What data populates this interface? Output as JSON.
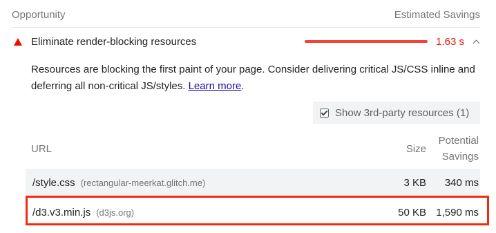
{
  "header": {
    "opportunity_label": "Opportunity",
    "savings_label": "Estimated Savings"
  },
  "audit": {
    "title": "Eliminate render-blocking resources",
    "savings_value": "1.63 s",
    "status_icon": "fail-triangle-icon",
    "status_color": "#eb0f00",
    "bar_color": "#f44336",
    "expanded": true,
    "description_text": "Resources are blocking the first paint of your page. Consider delivering critical JS/CSS inline and deferring all non-critical JS/styles.",
    "learn_more_label": "Learn more",
    "description_end": "."
  },
  "third_party_toggle": {
    "label": "Show 3rd-party resources (1)",
    "checked": true
  },
  "table": {
    "columns": {
      "url": "URL",
      "size": "Size",
      "savings": "Potential Savings"
    },
    "rows": [
      {
        "url": "/style.css",
        "host": "(rectangular-meerkat.glitch.me)",
        "size": "3 KB",
        "savings": "340 ms"
      },
      {
        "url": "/d3.v3.min.js",
        "host": "(d3js.org)",
        "size": "50 KB",
        "savings": "1,590 ms"
      }
    ]
  },
  "highlight_color": "#f22b0c"
}
